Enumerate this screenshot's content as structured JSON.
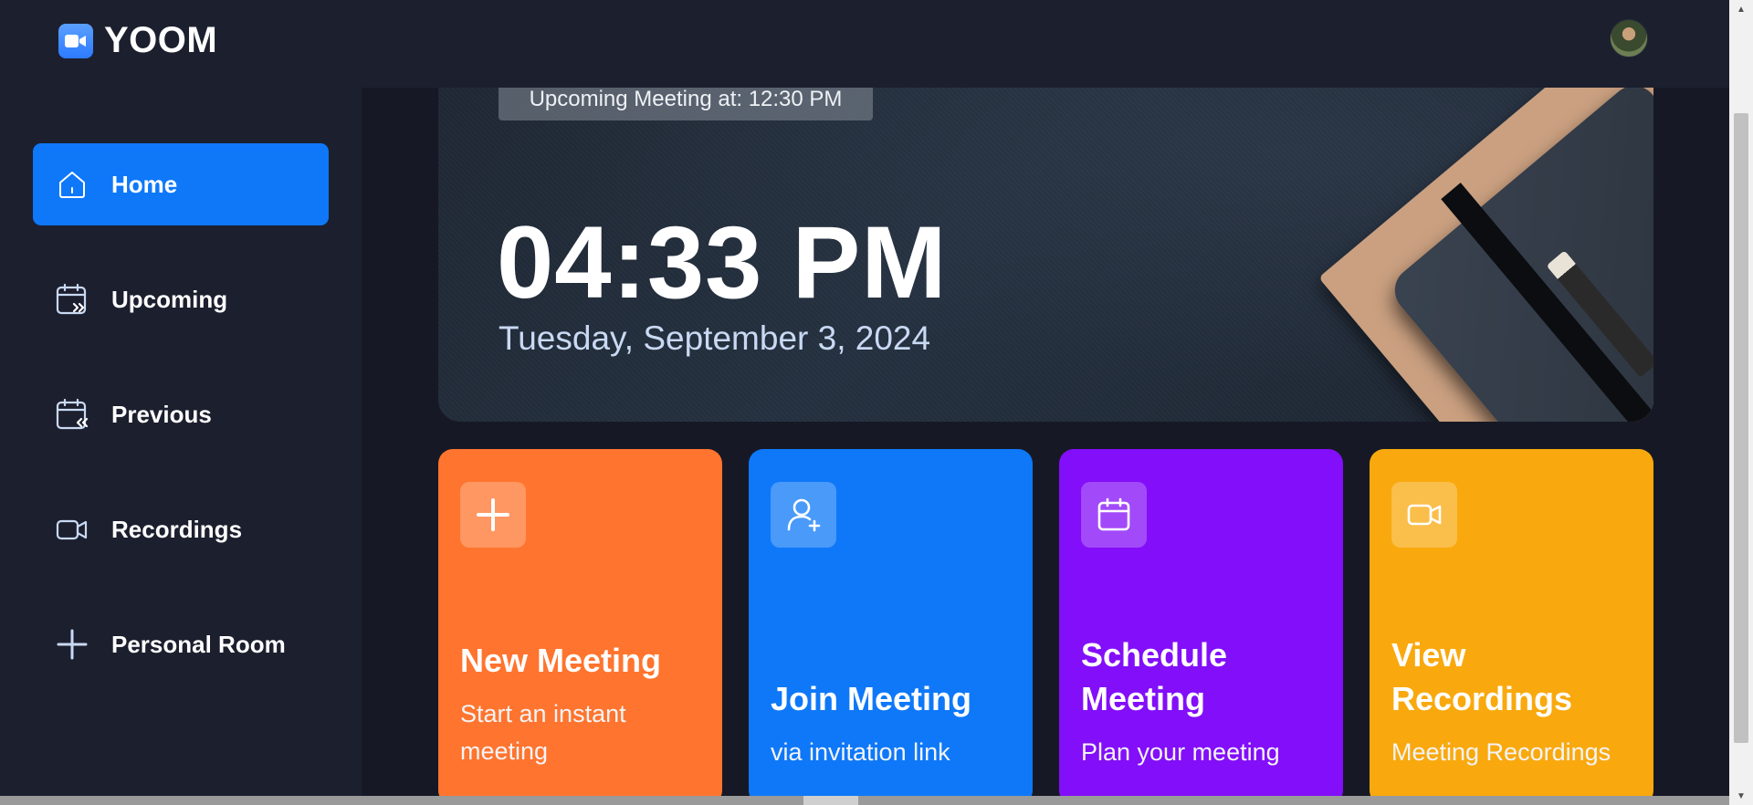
{
  "app": {
    "name": "YOOM"
  },
  "sidebar": {
    "items": [
      {
        "label": "Home",
        "icon": "home-icon",
        "active": true
      },
      {
        "label": "Upcoming",
        "icon": "calendar-forward-icon",
        "active": false
      },
      {
        "label": "Previous",
        "icon": "calendar-back-icon",
        "active": false
      },
      {
        "label": "Recordings",
        "icon": "video-icon",
        "active": false
      },
      {
        "label": "Personal Room",
        "icon": "plus-icon",
        "active": false
      }
    ]
  },
  "hero": {
    "upcoming_text": "Upcoming Meeting at: 12:30 PM",
    "time": "04:33 PM",
    "date": "Tuesday, September 3, 2024"
  },
  "cards": [
    {
      "title": "New Meeting",
      "subtitle": "Start an instant meeting",
      "icon": "plus-icon",
      "color": "#ff742e"
    },
    {
      "title": "Join Meeting",
      "subtitle": "via invitation link",
      "icon": "add-user-icon",
      "color": "#0e78f9"
    },
    {
      "title": "Schedule Meeting",
      "subtitle": "Plan your meeting",
      "icon": "calendar-icon",
      "color": "#830ef9"
    },
    {
      "title": "View Recordings",
      "subtitle": "Meeting Recordings",
      "icon": "video-icon",
      "color": "#f9a90e"
    }
  ],
  "colors": {
    "background": "#161925",
    "panel": "#1c1f2e",
    "accent": "#0e78f9"
  }
}
